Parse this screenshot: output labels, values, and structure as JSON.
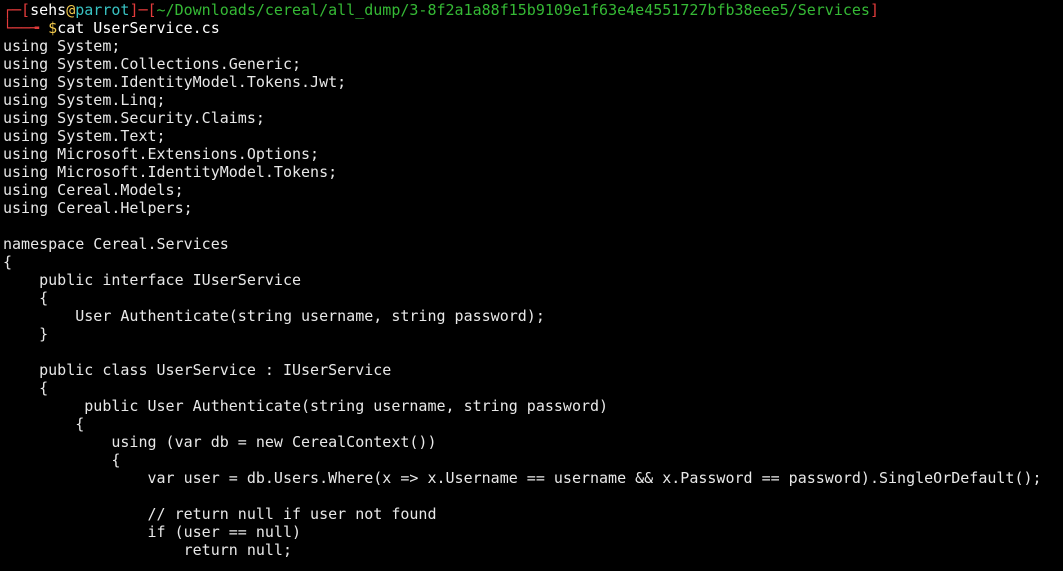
{
  "prompt": {
    "box_top_left": "┌─[",
    "user": "sehs",
    "at": "@",
    "host": "parrot",
    "sep": "]─[",
    "path": "~/Downloads/cereal/all_dump/3-8f2a1a88f15b9109e1f63e4e4551727bfb38eee5/Services",
    "box_close": "]",
    "box_bottom": "└──╼ ",
    "dollar": "$",
    "command": "cat UserService.cs"
  },
  "output_lines": [
    "using System;",
    "using System.Collections.Generic;",
    "using System.IdentityModel.Tokens.Jwt;",
    "using System.Linq;",
    "using System.Security.Claims;",
    "using System.Text;",
    "using Microsoft.Extensions.Options;",
    "using Microsoft.IdentityModel.Tokens;",
    "using Cereal.Models;",
    "using Cereal.Helpers;",
    "",
    "namespace Cereal.Services",
    "{",
    "    public interface IUserService",
    "    {",
    "        User Authenticate(string username, string password);",
    "    }",
    "",
    "    public class UserService : IUserService",
    "    {",
    "         public User Authenticate(string username, string password)",
    "        {",
    "            using (var db = new CerealContext())",
    "            {",
    "                var user = db.Users.Where(x => x.Username == username && x.Password == password).SingleOrDefault();",
    "",
    "                // return null if user not found",
    "                if (user == null)",
    "                    return null;"
  ]
}
